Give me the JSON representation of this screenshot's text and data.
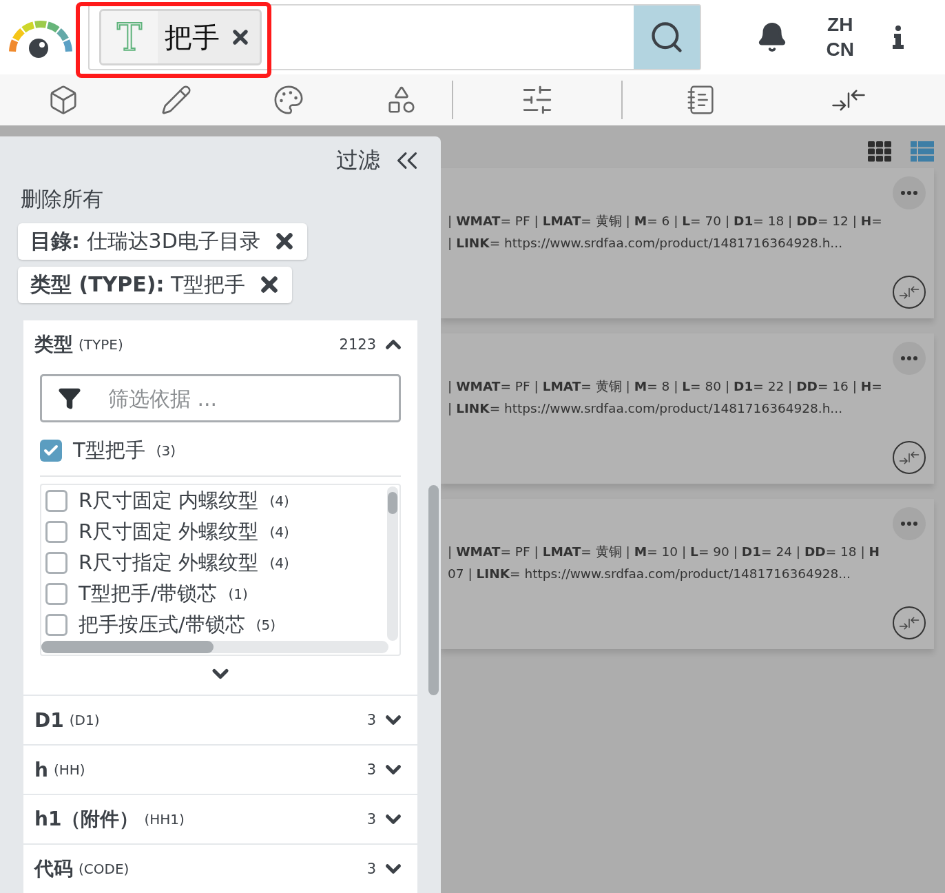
{
  "search": {
    "chip": {
      "type_icon": "T",
      "label": "把手"
    }
  },
  "header": {
    "language_lines": [
      "ZH",
      "CN"
    ]
  },
  "filter_panel": {
    "title": "过滤",
    "clear_all": "删除所有",
    "active_filters": [
      {
        "key": "目錄:",
        "value": "仕瑞达3D电子目录"
      },
      {
        "key": "类型 (TYPE):",
        "value": "T型把手"
      }
    ],
    "facets": [
      {
        "name": "类型",
        "code": "(TYPE)",
        "count": "2123",
        "expanded": true,
        "search_placeholder": "筛选依据 ...",
        "selected_options": [
          {
            "label": "T型把手",
            "count": "(3)",
            "checked": true
          }
        ],
        "options": [
          {
            "label": "R尺寸固定 内螺纹型",
            "count": "(4)",
            "checked": false
          },
          {
            "label": "R尺寸固定 外螺纹型",
            "count": "(4)",
            "checked": false
          },
          {
            "label": "R尺寸指定 外螺纹型",
            "count": "(4)",
            "checked": false
          },
          {
            "label": "T型把手/带锁芯",
            "count": "(1)",
            "checked": false
          },
          {
            "label": "把手按压式/带锁芯",
            "count": "(5)",
            "checked": false
          }
        ]
      },
      {
        "name": "D1",
        "code": "(D1)",
        "count": "3",
        "expanded": false
      },
      {
        "name": "h",
        "code": "(HH)",
        "count": "3",
        "expanded": false
      },
      {
        "name": "h1（附件）",
        "code": "(HH1)",
        "count": "3",
        "expanded": false
      },
      {
        "name": "代码",
        "code": "(CODE)",
        "count": "3",
        "expanded": false
      }
    ]
  },
  "view_modes": [
    {
      "kind": "grid",
      "selected": false
    },
    {
      "kind": "list",
      "selected": true
    }
  ],
  "results": [
    {
      "line_1": "| **WMAT**= PF | **LMAT**= 黄铜 | **M**= 6 | **L**= 70 | **D1**= 18 | **DD**= 12 | **H**=",
      "line_2": "| **LINK**= https://www.srdfaa.com/product/1481716364928.h..."
    },
    {
      "line_1": "| **WMAT**= PF | **LMAT**= 黄铜 | **M**= 8 | **L**= 80 | **D1**= 22 | **DD**= 16 | **H**=",
      "line_2": "| **LINK**= https://www.srdfaa.com/product/1481716364928.h..."
    },
    {
      "line_1": "| **WMAT**= PF | **LMAT**= 黄铜 | **M**= 10 | **L**= 90 | **D1**= 24 | **DD**= 18 | **H**",
      "line_2": "07 | **LINK**= https://www.srdfaa.com/product/1481716364928..."
    }
  ]
}
